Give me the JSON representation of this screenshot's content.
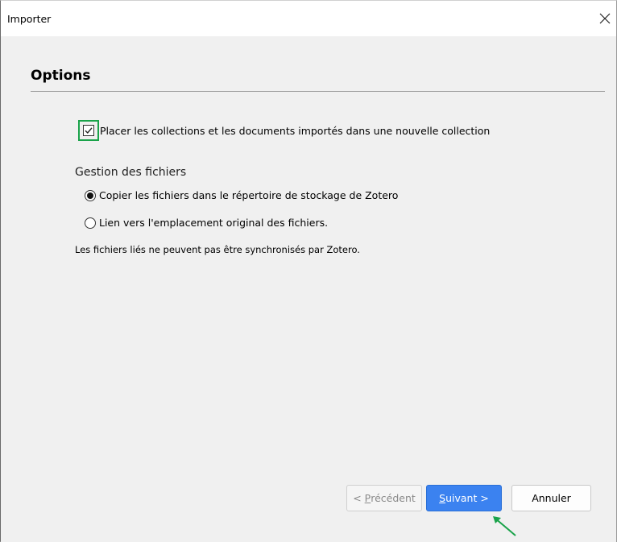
{
  "window": {
    "title": "Importer",
    "close_icon": "close-icon"
  },
  "options": {
    "heading": "Options",
    "new_collection_checkbox": {
      "label": "Placer les collections et les documents importés dans une nouvelle collection",
      "checked": true
    },
    "file_handling": {
      "label": "Gestion des fichiers",
      "options": [
        {
          "label": "Copier les fichiers dans le répertoire de stockage de Zotero",
          "selected": true
        },
        {
          "label": "Lien vers l'emplacement original des fichiers.",
          "selected": false
        }
      ],
      "note": "Les fichiers liés ne peuvent pas être synchronisés par Zotero."
    }
  },
  "buttons": {
    "previous": {
      "prefix": "< ",
      "mnemonic": "P",
      "rest": "récédent",
      "enabled": false
    },
    "next": {
      "mnemonic": "S",
      "rest": "uivant >",
      "enabled": true
    },
    "cancel": {
      "label": "Annuler"
    }
  },
  "colors": {
    "highlight": "#1aa34a",
    "primary_button": "#3b82f0",
    "annotation_arrow": "#1aa34a"
  }
}
